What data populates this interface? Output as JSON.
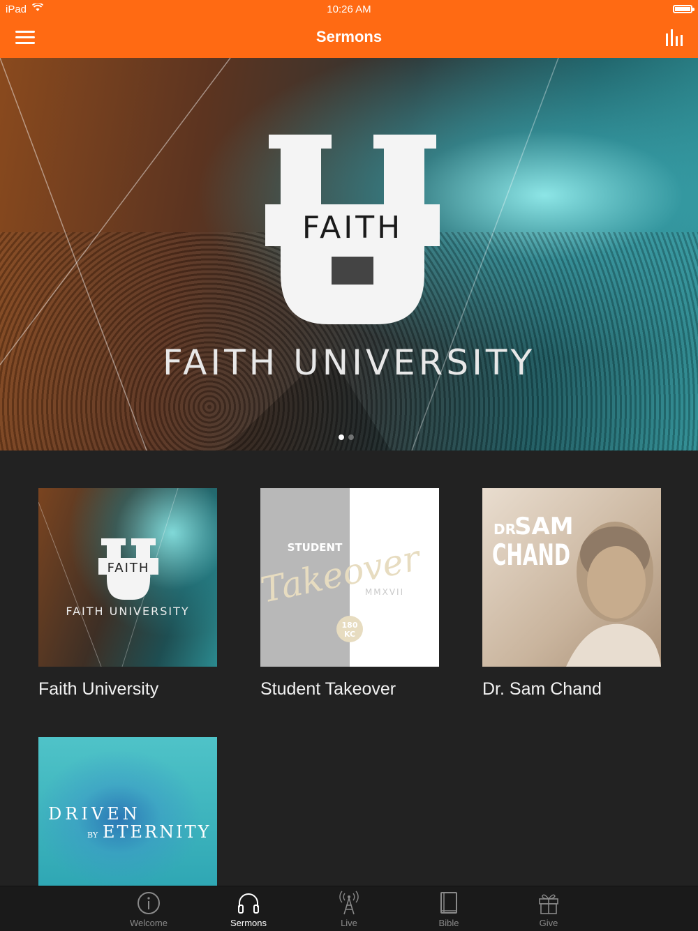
{
  "status_bar": {
    "carrier": "iPad",
    "time": "10:26 AM"
  },
  "nav": {
    "title": "Sermons"
  },
  "hero": {
    "logo_text": "FAITH",
    "title": "FAITH UNIVERSITY",
    "page_count": 2,
    "active_page": 1
  },
  "series": [
    {
      "label": "Faith University",
      "art_text": "FAITH",
      "art_subtitle": "FAITH UNIVERSITY"
    },
    {
      "label": "Student Takeover",
      "art_text": "Takeover",
      "art_top": "STUDENT",
      "art_year": "MMXVII",
      "art_badge_1": "180",
      "art_badge_2": "KC"
    },
    {
      "label": "Dr. Sam Chand",
      "art_prefix": "DR.",
      "art_text": "SAM",
      "art_text_2": "CHAND"
    },
    {
      "label": "",
      "art_text": "DRIVEN",
      "art_by": "BY",
      "art_text_2": "ETERNITY"
    }
  ],
  "tabs": [
    {
      "label": "Welcome",
      "icon": "info-icon",
      "active": false
    },
    {
      "label": "Sermons",
      "icon": "headphones-icon",
      "active": true
    },
    {
      "label": "Live",
      "icon": "broadcast-tower-icon",
      "active": false
    },
    {
      "label": "Bible",
      "icon": "book-icon",
      "active": false
    },
    {
      "label": "Give",
      "icon": "gift-icon",
      "active": false
    }
  ],
  "colors": {
    "accent": "#ff6a13",
    "background": "#222222",
    "tab_active": "#ffffff",
    "tab_inactive": "#8a8a8a"
  }
}
